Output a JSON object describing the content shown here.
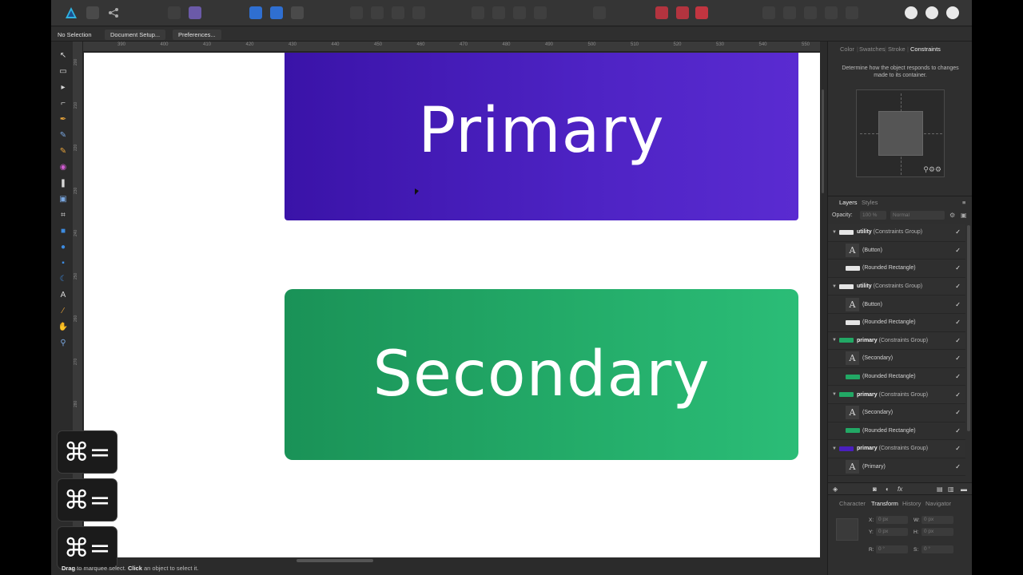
{
  "colors": {
    "primary_button": "#4a1fbe",
    "secondary_button": "#22a865",
    "canvas": "#ffffff",
    "app_bg": "#2b2b2b"
  },
  "toolbar": {
    "icons": [
      "affinity-logo-icon",
      "grid-icon",
      "share-icon",
      "persona-icon",
      "pixel-persona-icon",
      "align-icon"
    ]
  },
  "context": {
    "selection": "No Selection",
    "document_setup": "Document Setup...",
    "preferences": "Preferences..."
  },
  "ruler": {
    "h_ticks": [
      "390",
      "400",
      "410",
      "420",
      "430",
      "440",
      "450",
      "460",
      "470",
      "480",
      "490",
      "500",
      "510",
      "520",
      "530",
      "540",
      "550"
    ],
    "v_ticks": [
      "200",
      "210",
      "220",
      "230",
      "240",
      "250",
      "260",
      "270",
      "280"
    ]
  },
  "canvas": {
    "primary_label": "Primary",
    "secondary_label": "Secondary"
  },
  "shortcuts": [
    "⌘=",
    "⌘=",
    "⌘="
  ],
  "status": {
    "drag": "Drag",
    "drag_text": " to marquee select. ",
    "click": "Click",
    "click_text": " an object to select it."
  },
  "panel": {
    "top_tabs": [
      "Color",
      "Swatches",
      "Stroke",
      "Constraints"
    ],
    "active_top_tab": "Constraints",
    "constraints_description": "Determine how the object responds to changes made to its container.",
    "layers_tabs": [
      "Layers",
      "Styles"
    ],
    "opacity_label": "Opacity:",
    "opacity_value": "100 %",
    "blend_mode": "Normal",
    "layers": [
      {
        "type": "group",
        "name": "utility",
        "kind": "(Constraints Group)",
        "thumb": "#e5e5e5"
      },
      {
        "type": "text",
        "name": "(Button)"
      },
      {
        "type": "shape",
        "name": "(Rounded Rectangle)",
        "thumb": "#e5e5e5"
      },
      {
        "type": "group",
        "name": "utility",
        "kind": "(Constraints Group)",
        "thumb": "#e5e5e5"
      },
      {
        "type": "text",
        "name": "(Button)"
      },
      {
        "type": "shape",
        "name": "(Rounded Rectangle)",
        "thumb": "#e5e5e5"
      },
      {
        "type": "group",
        "name": "primary",
        "kind": "(Constraints Group)",
        "thumb": "#22a865"
      },
      {
        "type": "text",
        "name": "(Secondary)"
      },
      {
        "type": "shape",
        "name": "(Rounded Rectangle)",
        "thumb": "#22a865"
      },
      {
        "type": "group",
        "name": "primary",
        "kind": "(Constraints Group)",
        "thumb": "#22a865"
      },
      {
        "type": "text",
        "name": "(Secondary)"
      },
      {
        "type": "shape",
        "name": "(Rounded Rectangle)",
        "thumb": "#22a865"
      },
      {
        "type": "group",
        "name": "primary",
        "kind": "(Constraints Group)",
        "thumb": "#4a1fbe"
      },
      {
        "type": "text",
        "name": "(Primary)"
      }
    ],
    "bottom_tabs": [
      "Character",
      "Transform",
      "History",
      "Navigator"
    ],
    "active_bottom_tab": "Transform",
    "transform": {
      "x_label": "X:",
      "x": "0 px",
      "y_label": "Y:",
      "y": "0 px",
      "w_label": "W:",
      "w": "0 px",
      "h_label": "H:",
      "h": "0 px",
      "r_label": "R:",
      "r": "0 °",
      "s_label": "S:",
      "s": "0 °"
    }
  }
}
